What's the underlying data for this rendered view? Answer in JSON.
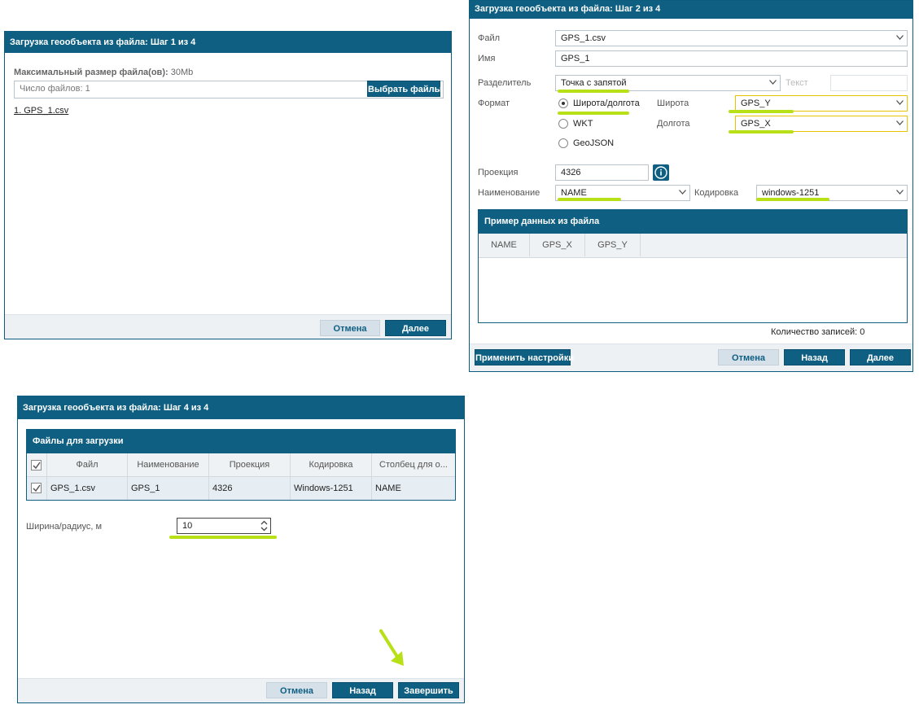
{
  "step1": {
    "title": "Загрузка геообъекта из файла: Шаг 1 из 4",
    "max_size_label": "Максимальный размер файла(ов):",
    "max_size_value": "30Mb",
    "files_count": "Число файлов: 1",
    "choose_files": "Выбрать файлы",
    "file_item": "1. GPS_1.csv",
    "cancel": "Отмена",
    "next": "Далее"
  },
  "step2": {
    "title": "Загрузка геообъекта из файла: Шаг 2 из 4",
    "file_label": "Файл",
    "file_value": "GPS_1.csv",
    "name_label": "Имя",
    "name_value": "GPS_1",
    "separator_label": "Разделитель",
    "separator_value": "Точка с запятой",
    "text_label": "Текст",
    "format_label": "Формат",
    "format_options": [
      "Широта/долгота",
      "WKT",
      "GeoJSON"
    ],
    "lat_label": "Широта",
    "lat_value": "GPS_Y",
    "lon_label": "Долгота",
    "lon_value": "GPS_X",
    "projection_label": "Проекция",
    "projection_value": "4326",
    "naming_label": "Наименование",
    "naming_value": "NAME",
    "encoding_label": "Кодировка",
    "encoding_value": "windows-1251",
    "sample_title": "Пример данных из файла",
    "sample_columns": [
      "NAME",
      "GPS_X",
      "GPS_Y"
    ],
    "records_count": "Количество записей: 0",
    "apply": "Применить настройки",
    "cancel": "Отмена",
    "back": "Назад",
    "next": "Далее"
  },
  "step4": {
    "title": "Загрузка геообъекта из файла: Шаг 4 из 4",
    "panel_title": "Файлы для загрузки",
    "columns": [
      "Файл",
      "Наименование",
      "Проекция",
      "Кодировка",
      "Столбец для о..."
    ],
    "row": [
      "GPS_1.csv",
      "GPS_1",
      "4326",
      "Windows-1251",
      "NAME"
    ],
    "radius_label": "Ширина/радиус, м",
    "radius_value": "10",
    "cancel": "Отмена",
    "back": "Назад",
    "finish": "Завершить"
  },
  "colors": {
    "accent": "#0e5f82",
    "highlight_green": "#b8e017",
    "highlight_yellow": "#e8c400"
  }
}
